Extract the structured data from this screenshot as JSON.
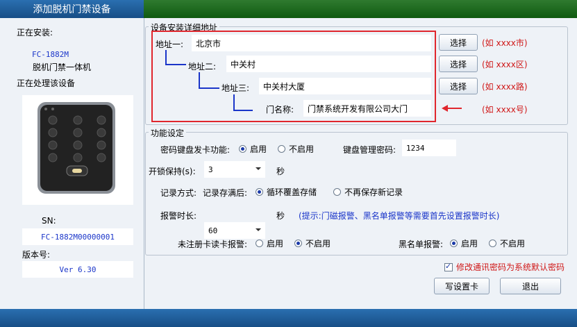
{
  "window": {
    "title": "添加脱机门禁设备"
  },
  "left": {
    "installing_label": "正在安装:",
    "model": "FC-1882M",
    "device_desc": "脱机门禁一体机",
    "processing_label": "正在处理该设备",
    "sn_label": "SN:",
    "sn_value": "FC-1882M00000001",
    "version_label": "版本号:",
    "version_value": "Ver 6.30"
  },
  "address": {
    "legend": "设备安装详细地址",
    "addr1_label": "地址一:",
    "addr1_value": "北京市",
    "addr2_label": "地址二:",
    "addr2_value": "中关村",
    "addr3_label": "地址三:",
    "addr3_value": "中关村大厦",
    "door_label": "门名称:",
    "door_value": "门禁系统开发有限公司大门",
    "select_label": "选择",
    "hint1": "(如 xxxx市)",
    "hint2": "(如 xxxx区)",
    "hint3": "(如 xxxx路)",
    "hint4": "(如 xxxx号)"
  },
  "func": {
    "legend": "功能设定",
    "keypad_card_label": "密码键盘发卡功能:",
    "enable": "启用",
    "disable": "不启用",
    "keypad_pwd_label": "键盘管理密码:",
    "keypad_pwd_value": "1234",
    "unlock_label": "开锁保持(s):",
    "unlock_value": "3",
    "seconds": "秒",
    "record_label": "记录方式:",
    "record_full_label": "记录存满后:",
    "record_opt1": "循环覆盖存储",
    "record_opt2": "不再保存新记录",
    "alarm_label": "报警时长:",
    "alarm_value": "60",
    "alarm_hint": "(提示:门磁报警、黑名单报警等需要首先设置报警时长)",
    "unreg_label": "未注册卡读卡报警:",
    "blacklist_label": "黑名单报警:"
  },
  "footer": {
    "modify_pwd_label": "修改通讯密码为系统默认密码",
    "write_card": "写设置卡",
    "exit": "退出"
  },
  "colors": {
    "accent_blue": "#1a35c9",
    "hint_red": "#d01818",
    "titlebar_green": "#0f5a10"
  }
}
